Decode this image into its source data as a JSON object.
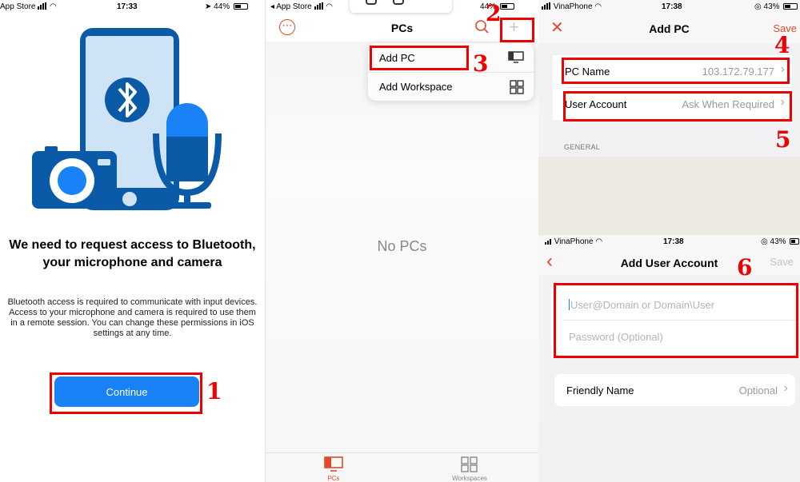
{
  "screen1": {
    "status": {
      "carrier": "App Store",
      "time": "17:33",
      "battery": "44%"
    },
    "title_line1": "We need to request access to Bluetooth,",
    "title_line2": "your microphone and camera",
    "description": "Bluetooth access is required to communicate with input devices. Access to your microphone and camera is required to use them in a remote session. You can change these permissions in iOS settings at any time.",
    "continue_label": "Continue",
    "step_marker": "1"
  },
  "screen2": {
    "status": {
      "carrier": "App Store",
      "battery": "44%"
    },
    "title": "PCs",
    "add_button_label": "+",
    "menu": [
      {
        "label": "Add PC",
        "icon": "desktop-icon"
      },
      {
        "label": "Add Workspace",
        "icon": "workspace-icon"
      }
    ],
    "empty_text": "No PCs",
    "tabs": [
      {
        "label": "PCs",
        "icon": "desktop-icon",
        "active": true
      },
      {
        "label": "Workspaces",
        "icon": "workspace-icon",
        "active": false
      }
    ],
    "step_markers": [
      "2",
      "3"
    ]
  },
  "screen3": {
    "status": {
      "carrier": "VinaPhone",
      "time": "17:38",
      "battery": "43%"
    },
    "close_label": "✕",
    "title": "Add PC",
    "save_label": "Save",
    "pc_name_label": "PC Name",
    "pc_name_value": "103.172.79.177",
    "user_account_label": "User Account",
    "user_account_value": "Ask When Required",
    "section_general": "GENERAL",
    "step_markers": [
      "4",
      "5"
    ]
  },
  "screen4": {
    "status": {
      "carrier": "VinaPhone",
      "time": "17:38",
      "battery": "43%"
    },
    "back_label": "‹",
    "title": "Add User Account",
    "save_label": "Save",
    "user_placeholder": "User@Domain or Domain\\User",
    "password_placeholder": "Password (Optional)",
    "friendly_name_label": "Friendly Name",
    "friendly_name_value": "Optional",
    "step_marker": "6"
  },
  "colors": {
    "accent": "#e04a2a",
    "primary_button": "#1882f6",
    "annotation": "#ee0000",
    "bluetooth_blue": "#0a5aa8",
    "illustration_light": "#cfe3f7"
  }
}
